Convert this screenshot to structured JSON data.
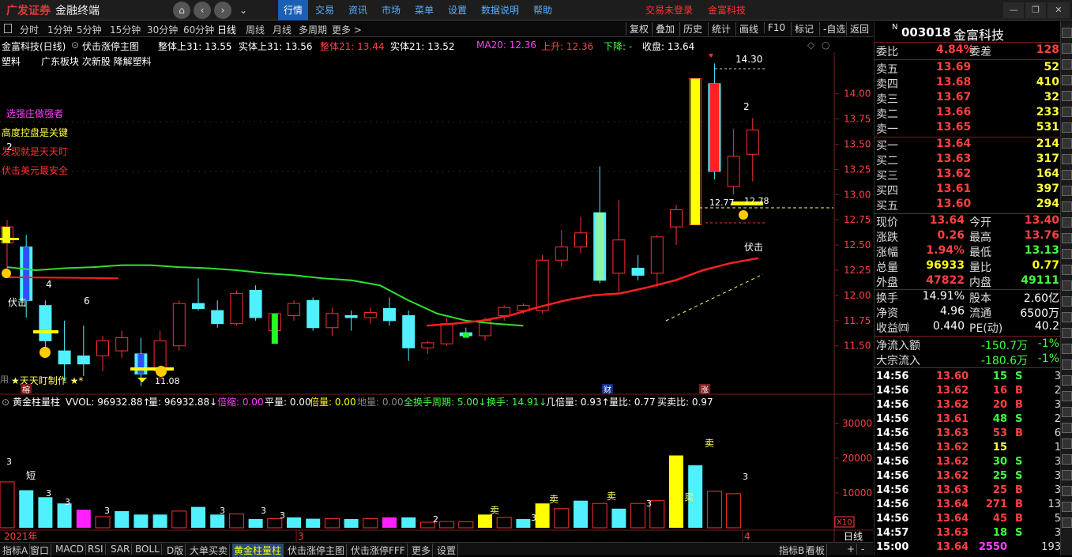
{
  "app": {
    "logo": "广发证券",
    "subtitle": "金融终端"
  },
  "top_menu": [
    "行情",
    "交易",
    "资讯",
    "市场",
    "菜单",
    "设置",
    "数据说明",
    "帮助"
  ],
  "top_links": {
    "login": "交易未登录",
    "stock": "金富科技"
  },
  "periods": [
    "分时",
    "1分钟",
    "5分钟",
    "15分钟",
    "30分钟",
    "60分钟",
    "日线",
    "周线",
    "月线",
    "多周期",
    "更多 >"
  ],
  "active_period": "日线",
  "toolbar_right": [
    "复权",
    "叠加",
    "历史",
    "统计",
    "画线",
    "F10",
    "标记",
    "-自选",
    "返回"
  ],
  "info": {
    "name": "金富科技(日线)",
    "indicator": "伏击涨停主图",
    "items": [
      {
        "t": "整体上31: 13.55",
        "c": "#fff"
      },
      {
        "t": "实体上31: 13.56",
        "c": "#fff"
      },
      {
        "t": "整体21: 13.44",
        "c": "#ff4040"
      },
      {
        "t": "实体21: 13.52",
        "c": "#fff"
      },
      {
        "t": "MA20: 12.36",
        "c": "#ff40ff"
      },
      {
        "t": "上升: 12.36",
        "c": "#ff4040"
      },
      {
        "t": "下降: -",
        "c": "#40ff40"
      },
      {
        "t": "收盘: 13.64",
        "c": "#fff"
      }
    ]
  },
  "tags": {
    "industry": "塑料",
    "board": "广东板块 次新股 降解塑料"
  },
  "slogans": [
    "选强庄做强者",
    "高度控盘是关键",
    "发现就是天天盯",
    "伏击美元最安全"
  ],
  "annotations": {
    "a14_30": "14.30",
    "a12_77": "12.77",
    "a12_78": "12.78",
    "a11_08": "11.08",
    "fuji1": "伏击",
    "fuji2": "伏击",
    "n4": "4",
    "n6": "6",
    "n2": "2",
    "n2b": "2",
    "tianyan": "天天盯制作",
    "yongtian": "用",
    "rong": "榕",
    "cai": "财",
    "zhang": "涨"
  },
  "price_axis": [
    "14.00",
    "13.75",
    "13.50",
    "13.25",
    "13.00",
    "12.75",
    "12.50",
    "12.25",
    "12.00",
    "11.75",
    "11.50"
  ],
  "vol_header": [
    {
      "t": "黄金柱量柱",
      "c": "#fff"
    },
    {
      "t": "VVOL: 96932.88↑",
      "c": "#fff"
    },
    {
      "t": "量: 96932.88↓",
      "c": "#fff"
    },
    {
      "t": "倍缩: 0.00",
      "c": "#ff40ff"
    },
    {
      "t": "平量: 0.00",
      "c": "#fff"
    },
    {
      "t": "倍量: 0.00",
      "c": "#ffff00"
    },
    {
      "t": "地量: 0.00",
      "c": "#888"
    },
    {
      "t": "全换手周期: 5.00↓",
      "c": "#40ff40"
    },
    {
      "t": "换手: 14.91↓",
      "c": "#40ff40"
    },
    {
      "t": "几倍量: 0.93↑",
      "c": "#fff"
    },
    {
      "t": "量比: 0.77",
      "c": "#fff"
    },
    {
      "t": "买卖比: 0.97",
      "c": "#fff"
    }
  ],
  "vol_axis": [
    "30000",
    "20000",
    "10000"
  ],
  "vol_unit": "X10",
  "vol_labels": {
    "duan": "短",
    "mai": "卖"
  },
  "date_axis": {
    "y2021": "2021年",
    "m3": "3",
    "m4": "4"
  },
  "bottom_tabs": [
    "指标A",
    "窗口",
    "MACD",
    "RSI",
    "SAR",
    "BOLL",
    "D版",
    "大单买卖",
    "黄金柱量柱",
    "伏击涨停主图",
    "伏击涨停FFF",
    "更多",
    "设置"
  ],
  "active_tab": "黄金柱量柱",
  "bottom_right": {
    "zhibiao": "指标B",
    "ban": "看板",
    "day": "日线"
  },
  "stock": {
    "flag": "N",
    "code": "003018",
    "name": "金富科技"
  },
  "weibi": {
    "label1": "委比",
    "val1": "4.84%",
    "label2": "委差",
    "val2": "128"
  },
  "sell": [
    {
      "l": "卖五",
      "p": "13.69",
      "v": "52"
    },
    {
      "l": "卖四",
      "p": "13.68",
      "v": "410"
    },
    {
      "l": "卖三",
      "p": "13.67",
      "v": "32"
    },
    {
      "l": "卖二",
      "p": "13.66",
      "v": "233"
    },
    {
      "l": "卖一",
      "p": "13.65",
      "v": "531"
    }
  ],
  "buy": [
    {
      "l": "买一",
      "p": "13.64",
      "v": "214"
    },
    {
      "l": "买二",
      "p": "13.63",
      "v": "317"
    },
    {
      "l": "买三",
      "p": "13.62",
      "v": "164"
    },
    {
      "l": "买四",
      "p": "13.61",
      "v": "397"
    },
    {
      "l": "买五",
      "p": "13.60",
      "v": "294"
    }
  ],
  "quote": [
    {
      "l1": "现价",
      "v1": "13.64",
      "c1": "#ff4040",
      "l2": "今开",
      "v2": "13.40",
      "c2": "#ff4040"
    },
    {
      "l1": "涨跌",
      "v1": "0.26",
      "c1": "#ff4040",
      "l2": "最高",
      "v2": "13.76",
      "c2": "#ff4040"
    },
    {
      "l1": "涨幅",
      "v1": "1.94%",
      "c1": "#ff4040",
      "l2": "最低",
      "v2": "13.13",
      "c2": "#40ff40"
    },
    {
      "l1": "总量",
      "v1": "96933",
      "c1": "#ffff00",
      "l2": "量比",
      "v2": "0.77",
      "c2": "#ffff00"
    },
    {
      "l1": "外盘",
      "v1": "47822",
      "c1": "#ff4040",
      "l2": "内盘",
      "v2": "49111",
      "c2": "#40ff40"
    }
  ],
  "quote2": [
    {
      "l1": "换手",
      "v1": "14.91%",
      "l2": "股本",
      "v2": "2.60亿"
    },
    {
      "l1": "净资",
      "v1": "4.96",
      "l2": "流通",
      "v2": "6500万"
    },
    {
      "l1": "收益㈣",
      "v1": "0.440",
      "l2": "PE(动)",
      "v2": "40.2"
    }
  ],
  "flows": [
    {
      "l": "净流入额",
      "v": "-150.7万",
      "p": "-1%"
    },
    {
      "l": "大宗流入",
      "v": "-180.6万",
      "p": "-1%"
    }
  ],
  "ticks": [
    {
      "t": "14:56",
      "p": "13.60",
      "v": "15",
      "s": "S",
      "n": "3"
    },
    {
      "t": "14:56",
      "p": "13.62",
      "v": "16",
      "s": "B",
      "n": "2"
    },
    {
      "t": "14:56",
      "p": "13.62",
      "v": "20",
      "s": "B",
      "n": "3"
    },
    {
      "t": "14:56",
      "p": "13.61",
      "v": "48",
      "s": "S",
      "n": "2"
    },
    {
      "t": "14:56",
      "p": "13.63",
      "v": "53",
      "s": "B",
      "n": "6"
    },
    {
      "t": "14:56",
      "p": "13.62",
      "v": "15",
      "s": "",
      "n": "1"
    },
    {
      "t": "14:56",
      "p": "13.62",
      "v": "30",
      "s": "S",
      "n": "3"
    },
    {
      "t": "14:56",
      "p": "13.62",
      "v": "25",
      "s": "S",
      "n": "3"
    },
    {
      "t": "14:56",
      "p": "13.63",
      "v": "25",
      "s": "B",
      "n": "3"
    },
    {
      "t": "14:56",
      "p": "13.64",
      "v": "271",
      "s": "B",
      "n": "13"
    },
    {
      "t": "14:56",
      "p": "13.64",
      "v": "45",
      "s": "B",
      "n": "5"
    },
    {
      "t": "14:57",
      "p": "13.63",
      "v": "18",
      "s": "S",
      "n": "3"
    },
    {
      "t": "15:00",
      "p": "13.64",
      "v": "2550",
      "s": "",
      "n": "193"
    }
  ],
  "chart_data": {
    "type": "candlestick",
    "price_ylim": [
      11.2,
      14.35
    ],
    "vol_ylim": [
      0,
      35000
    ],
    "candles": [
      {
        "o": 12.52,
        "h": 12.75,
        "l": 12.2,
        "c": 12.68,
        "up": true
      },
      {
        "o": 12.48,
        "h": 12.6,
        "l": 11.78,
        "c": 11.95,
        "up": false
      },
      {
        "o": 11.9,
        "h": 11.95,
        "l": 11.45,
        "c": 11.55,
        "up": false
      },
      {
        "o": 11.45,
        "h": 11.75,
        "l": 11.15,
        "c": 11.32,
        "up": false
      },
      {
        "o": 11.32,
        "h": 11.7,
        "l": 11.2,
        "c": 11.4,
        "up": false
      },
      {
        "o": 11.4,
        "h": 11.6,
        "l": 11.25,
        "c": 11.55,
        "up": true
      },
      {
        "o": 11.58,
        "h": 11.65,
        "l": 11.38,
        "c": 11.45,
        "up": true
      },
      {
        "o": 11.42,
        "h": 11.58,
        "l": 11.1,
        "c": 11.22,
        "up": false
      },
      {
        "o": 11.25,
        "h": 11.65,
        "l": 11.15,
        "c": 11.55,
        "up": true
      },
      {
        "o": 11.5,
        "h": 11.95,
        "l": 11.45,
        "c": 11.92,
        "up": true
      },
      {
        "o": 11.92,
        "h": 12.17,
        "l": 11.85,
        "c": 11.87,
        "up": false
      },
      {
        "o": 11.85,
        "h": 11.95,
        "l": 11.68,
        "c": 11.72,
        "up": false
      },
      {
        "o": 11.72,
        "h": 12.05,
        "l": 11.7,
        "c": 12.02,
        "up": true
      },
      {
        "o": 12.05,
        "h": 12.1,
        "l": 11.75,
        "c": 11.78,
        "up": false
      },
      {
        "o": 11.65,
        "h": 11.82,
        "l": 11.52,
        "c": 11.82,
        "up": true
      },
      {
        "o": 11.8,
        "h": 11.95,
        "l": 11.75,
        "c": 11.92,
        "up": true
      },
      {
        "o": 11.95,
        "h": 11.98,
        "l": 11.65,
        "c": 11.68,
        "up": false
      },
      {
        "o": 11.68,
        "h": 11.88,
        "l": 11.6,
        "c": 11.82,
        "up": true
      },
      {
        "o": 11.8,
        "h": 11.85,
        "l": 11.65,
        "c": 11.78,
        "up": false
      },
      {
        "o": 11.78,
        "h": 11.88,
        "l": 11.72,
        "c": 11.83,
        "up": true
      },
      {
        "o": 11.87,
        "h": 11.98,
        "l": 11.7,
        "c": 11.75,
        "up": false
      },
      {
        "o": 11.8,
        "h": 11.85,
        "l": 11.35,
        "c": 11.48,
        "up": false
      },
      {
        "o": 11.48,
        "h": 11.55,
        "l": 11.42,
        "c": 11.53,
        "up": true
      },
      {
        "o": 11.52,
        "h": 11.78,
        "l": 11.5,
        "c": 11.72,
        "up": true
      },
      {
        "o": 11.63,
        "h": 11.68,
        "l": 11.58,
        "c": 11.6,
        "up": false
      },
      {
        "o": 11.6,
        "h": 11.78,
        "l": 11.55,
        "c": 11.75,
        "up": true
      },
      {
        "o": 11.8,
        "h": 11.9,
        "l": 11.75,
        "c": 11.88,
        "up": true
      },
      {
        "o": 11.85,
        "h": 11.92,
        "l": 11.82,
        "c": 11.9,
        "up": true
      },
      {
        "o": 11.85,
        "h": 12.4,
        "l": 11.82,
        "c": 12.35,
        "up": true
      },
      {
        "o": 12.35,
        "h": 12.65,
        "l": 12.28,
        "c": 12.48,
        "up": true
      },
      {
        "o": 12.48,
        "h": 12.78,
        "l": 12.42,
        "c": 12.62,
        "up": true
      },
      {
        "o": 12.15,
        "h": 13.28,
        "l": 12.12,
        "c": 12.82,
        "up": false
      },
      {
        "o": 12.55,
        "h": 12.95,
        "l": 12.03,
        "c": 12.22,
        "up": true
      },
      {
        "o": 12.27,
        "h": 12.4,
        "l": 12.15,
        "c": 12.2,
        "up": false
      },
      {
        "o": 12.22,
        "h": 12.6,
        "l": 12.08,
        "c": 12.58,
        "up": true
      },
      {
        "o": 12.68,
        "h": 12.9,
        "l": 12.5,
        "c": 12.85,
        "up": true
      },
      {
        "o": 12.7,
        "h": 14.15,
        "l": 12.7,
        "c": 14.15,
        "up": true
      },
      {
        "o": 14.1,
        "h": 14.3,
        "l": 13.15,
        "c": 13.23,
        "up": false
      },
      {
        "o": 13.08,
        "h": 13.65,
        "l": 13.0,
        "c": 13.38,
        "up": true
      },
      {
        "o": 13.4,
        "h": 13.76,
        "l": 13.13,
        "c": 13.64,
        "up": true
      }
    ],
    "volumes": [
      {
        "v": 13200,
        "k": "r"
      },
      {
        "v": 10800,
        "k": "c"
      },
      {
        "v": 8800,
        "k": "c"
      },
      {
        "v": 7000,
        "k": "c"
      },
      {
        "v": 5200,
        "k": "m"
      },
      {
        "v": 3200,
        "k": "r"
      },
      {
        "v": 4800,
        "k": "c"
      },
      {
        "v": 3800,
        "k": "c"
      },
      {
        "v": 3800,
        "k": "c"
      },
      {
        "v": 4800,
        "k": "r"
      },
      {
        "v": 6000,
        "k": "c"
      },
      {
        "v": 3800,
        "k": "c"
      },
      {
        "v": 4000,
        "k": "r"
      },
      {
        "v": 2500,
        "k": "c"
      },
      {
        "v": 2600,
        "k": "r"
      },
      {
        "v": 3000,
        "k": "c"
      },
      {
        "v": 2600,
        "k": "c"
      },
      {
        "v": 2600,
        "k": "r"
      },
      {
        "v": 2500,
        "k": "c"
      },
      {
        "v": 2600,
        "k": "r"
      },
      {
        "v": 3000,
        "k": "m"
      },
      {
        "v": 3000,
        "k": "c"
      },
      {
        "v": 1600,
        "k": "r"
      },
      {
        "v": 1800,
        "k": "r"
      },
      {
        "v": 1700,
        "k": "r"
      },
      {
        "v": 3800,
        "k": "y"
      },
      {
        "v": 3000,
        "k": "r"
      },
      {
        "v": 2500,
        "k": "c"
      },
      {
        "v": 7000,
        "k": "y"
      },
      {
        "v": 5500,
        "k": "r"
      },
      {
        "v": 7800,
        "k": "c"
      },
      {
        "v": 7000,
        "k": "r"
      },
      {
        "v": 5500,
        "k": "c"
      },
      {
        "v": 7000,
        "k": "r"
      },
      {
        "v": 7800,
        "k": "r"
      },
      {
        "v": 20800,
        "k": "y"
      },
      {
        "v": 18000,
        "k": "c"
      },
      {
        "v": 10500,
        "k": "r"
      },
      {
        "v": 9800,
        "k": "r"
      }
    ],
    "ma_green": [
      12.28,
      12.25,
      12.27,
      12.28,
      12.3,
      12.3,
      12.28,
      12.27,
      12.25,
      12.22,
      12.2,
      12.17,
      12.15,
      12.1,
      11.95,
      11.82,
      11.75,
      11.72,
      11.7
    ],
    "ma_red": [
      11.7,
      11.72,
      11.75,
      11.8,
      11.88,
      11.95,
      12.0,
      12.02,
      12.08,
      12.15,
      12.25,
      12.32,
      12.37
    ]
  }
}
